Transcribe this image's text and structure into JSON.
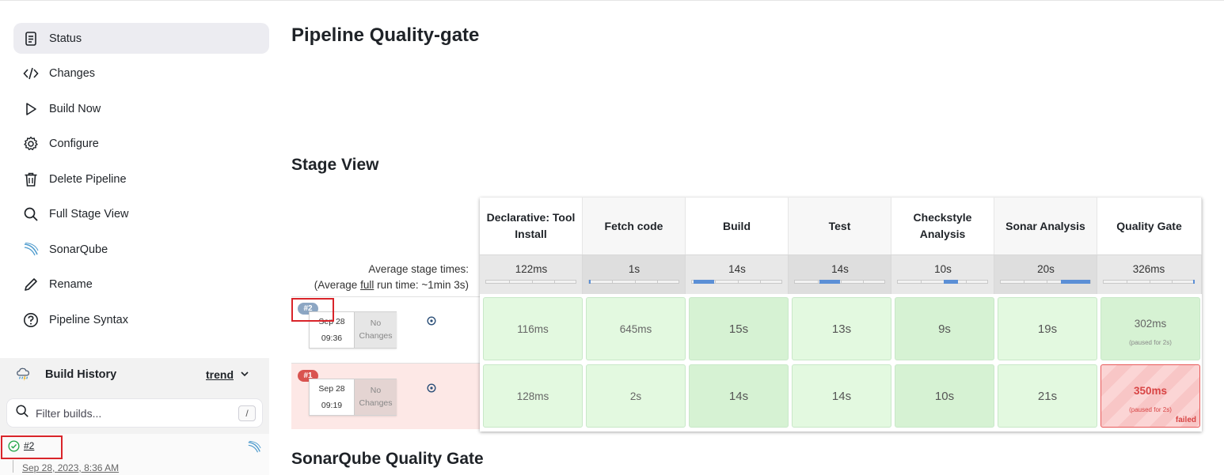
{
  "sidebar": {
    "items": [
      {
        "label": "Status",
        "icon": "document-icon"
      },
      {
        "label": "Changes",
        "icon": "code-icon"
      },
      {
        "label": "Build Now",
        "icon": "play-icon"
      },
      {
        "label": "Configure",
        "icon": "gear-icon"
      },
      {
        "label": "Delete Pipeline",
        "icon": "trash-icon"
      },
      {
        "label": "Full Stage View",
        "icon": "search-icon"
      },
      {
        "label": "SonarQube",
        "icon": "sonarqube-icon"
      },
      {
        "label": "Rename",
        "icon": "pencil-icon"
      },
      {
        "label": "Pipeline Syntax",
        "icon": "help-icon"
      }
    ],
    "active_item": "Status"
  },
  "build_history": {
    "title": "Build History",
    "trend_label": "trend",
    "filter_placeholder": "Filter builds...",
    "filter_shortcut": "/",
    "entries": [
      {
        "number": "#2",
        "date": "Sep 28, 2023, 8:36 AM",
        "status": "success"
      }
    ]
  },
  "main": {
    "title": "Pipeline Quality-gate",
    "stage_view_heading": "Stage View",
    "sonar_heading": "SonarQube Quality Gate",
    "avg_label_line1": "Average stage times:",
    "avg_label_prefix": "(Average ",
    "avg_label_link": "full",
    "avg_label_suffix": " run time: ~1min 3s)"
  },
  "stage_view": {
    "stages": [
      {
        "name": "Declarative: Tool Install",
        "avg": "122ms",
        "bar_start": 0.0,
        "bar_end": 0.0
      },
      {
        "name": "Fetch code",
        "avg": "1s",
        "bar_start": 0.0,
        "bar_end": 0.02
      },
      {
        "name": "Build",
        "avg": "14s",
        "bar_start": 0.02,
        "bar_end": 0.25
      },
      {
        "name": "Test",
        "avg": "14s",
        "bar_start": 0.27,
        "bar_end": 0.5
      },
      {
        "name": "Checkstyle Analysis",
        "avg": "10s",
        "bar_start": 0.5,
        "bar_end": 0.66
      },
      {
        "name": "Sonar Analysis",
        "avg": "20s",
        "bar_start": 0.66,
        "bar_end": 0.98
      },
      {
        "name": "Quality Gate",
        "avg": "326ms",
        "bar_start": 0.98,
        "bar_end": 1.0
      }
    ],
    "builds": [
      {
        "number": "#2",
        "badge_color": "#8ca6c3",
        "date": "Sep 28",
        "time": "09:36",
        "changes": "No Changes",
        "row_status": "success",
        "cells": [
          {
            "value": "116ms",
            "paused": ""
          },
          {
            "value": "645ms",
            "paused": ""
          },
          {
            "value": "15s",
            "paused": ""
          },
          {
            "value": "13s",
            "paused": ""
          },
          {
            "value": "9s",
            "paused": ""
          },
          {
            "value": "19s",
            "paused": ""
          },
          {
            "value": "302ms",
            "paused": "(paused for 2s)"
          }
        ]
      },
      {
        "number": "#1",
        "badge_color": "#d9534f",
        "date": "Sep 28",
        "time": "09:19",
        "changes": "No Changes",
        "row_status": "failed",
        "cells": [
          {
            "value": "128ms",
            "paused": ""
          },
          {
            "value": "2s",
            "paused": ""
          },
          {
            "value": "14s",
            "paused": ""
          },
          {
            "value": "14s",
            "paused": ""
          },
          {
            "value": "10s",
            "paused": ""
          },
          {
            "value": "21s",
            "paused": ""
          },
          {
            "value": "350ms",
            "paused": "(paused for 2s)",
            "status_label": "failed"
          }
        ]
      }
    ]
  },
  "colors": {
    "success_cell": "#e3f9e0",
    "failed_row": "#fde8e6",
    "failed_text": "#d84444",
    "bar_fill": "#5b8fd6"
  }
}
